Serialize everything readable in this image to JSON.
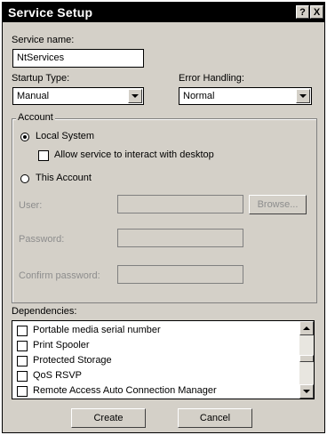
{
  "window": {
    "title": "Service Setup",
    "help_button": "?",
    "close_button": "X"
  },
  "service_name": {
    "label": "Service name:",
    "value": "NtServices"
  },
  "startup_type": {
    "label": "Startup Type:",
    "value": "Manual"
  },
  "error_handling": {
    "label": "Error Handling:",
    "value": "Normal"
  },
  "account": {
    "group_label": "Account",
    "local_system_label": "Local System",
    "local_system_selected": true,
    "interact_desktop_label": "Allow service to interact with desktop",
    "interact_desktop_checked": false,
    "this_account_label": "This Account",
    "this_account_selected": false,
    "user_label": "User:",
    "user_value": "",
    "browse_button": "Browse...",
    "password_label": "Password:",
    "password_value": "",
    "confirm_password_label": "Confirm password:",
    "confirm_password_value": ""
  },
  "dependencies": {
    "label": "Dependencies:",
    "items": [
      {
        "label": "Portable media serial number",
        "checked": false
      },
      {
        "label": "Print Spooler",
        "checked": false
      },
      {
        "label": "Protected Storage",
        "checked": false
      },
      {
        "label": "QoS RSVP",
        "checked": false
      },
      {
        "label": "Remote Access Auto Connection Manager",
        "checked": false
      }
    ]
  },
  "buttons": {
    "create": "Create",
    "cancel": "Cancel"
  }
}
